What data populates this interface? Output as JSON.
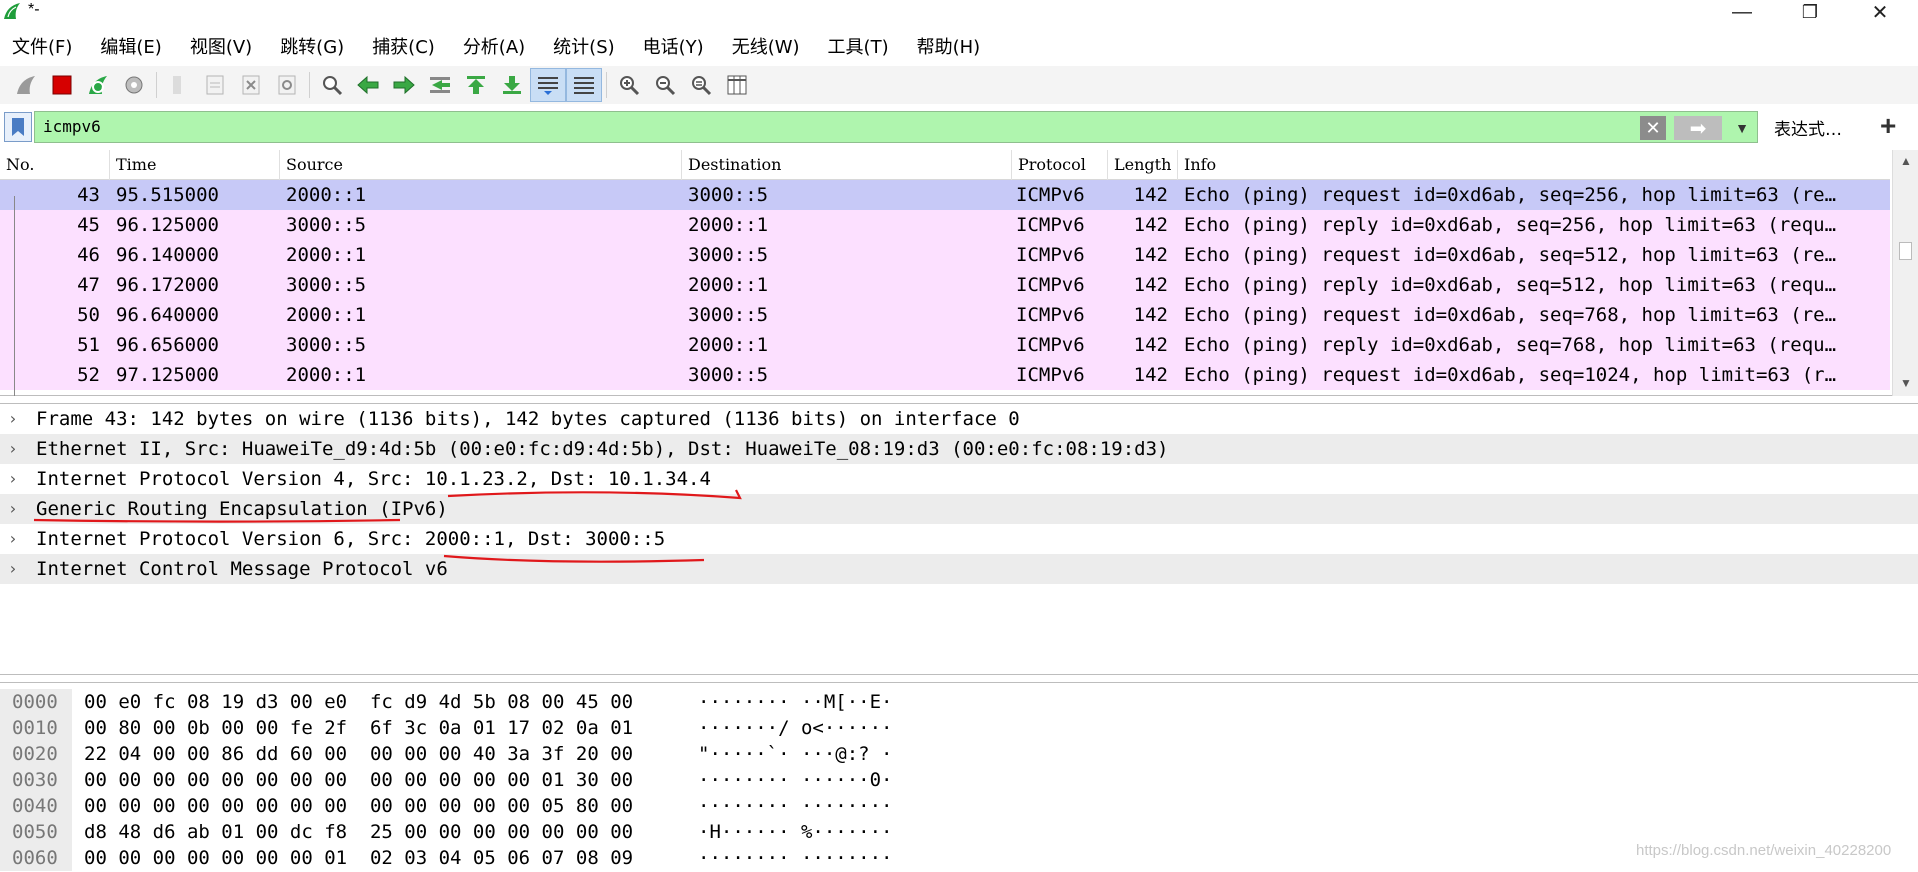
{
  "window": {
    "title": "*-",
    "minimize": "—",
    "restore": "❐",
    "close": "✕"
  },
  "menu": [
    "文件(F)",
    "编辑(E)",
    "视图(V)",
    "跳转(G)",
    "捕获(C)",
    "分析(A)",
    "统计(S)",
    "电话(Y)",
    "无线(W)",
    "工具(T)",
    "帮助(H)"
  ],
  "toolbar_icons": [
    "shark-fin-start-icon",
    "stop-capture-icon",
    "restart-capture-icon",
    "capture-options-icon",
    "open-file-icon",
    "save-file-icon",
    "close-file-icon",
    "reload-icon",
    "find-packet-icon",
    "go-back-icon",
    "go-forward-icon",
    "go-to-packet-icon",
    "go-first-icon",
    "go-last-icon",
    "autoscroll-icon",
    "colorize-icon",
    "zoom-in-icon",
    "zoom-out-icon",
    "zoom-normal-icon",
    "resize-columns-icon"
  ],
  "filter": {
    "value": "icmpv6",
    "expression_label": "表达式…",
    "add_label": "+"
  },
  "packet_list": {
    "columns": [
      "No.",
      "Time",
      "Source",
      "Destination",
      "Protocol",
      "Length",
      "Info"
    ],
    "rows": [
      {
        "no": "43",
        "time": "95.515000",
        "source": "2000::1",
        "destination": "3000::5",
        "protocol": "ICMPv6",
        "length": "142",
        "info": "Echo (ping) request id=0xd6ab, seq=256, hop limit=63 (re…"
      },
      {
        "no": "45",
        "time": "96.125000",
        "source": "3000::5",
        "destination": "2000::1",
        "protocol": "ICMPv6",
        "length": "142",
        "info": "Echo (ping) reply id=0xd6ab, seq=256, hop limit=63 (requ…"
      },
      {
        "no": "46",
        "time": "96.140000",
        "source": "2000::1",
        "destination": "3000::5",
        "protocol": "ICMPv6",
        "length": "142",
        "info": "Echo (ping) request id=0xd6ab, seq=512, hop limit=63 (re…"
      },
      {
        "no": "47",
        "time": "96.172000",
        "source": "3000::5",
        "destination": "2000::1",
        "protocol": "ICMPv6",
        "length": "142",
        "info": "Echo (ping) reply id=0xd6ab, seq=512, hop limit=63 (requ…"
      },
      {
        "no": "50",
        "time": "96.640000",
        "source": "2000::1",
        "destination": "3000::5",
        "protocol": "ICMPv6",
        "length": "142",
        "info": "Echo (ping) request id=0xd6ab, seq=768, hop limit=63 (re…"
      },
      {
        "no": "51",
        "time": "96.656000",
        "source": "3000::5",
        "destination": "2000::1",
        "protocol": "ICMPv6",
        "length": "142",
        "info": "Echo (ping) reply id=0xd6ab, seq=768, hop limit=63 (requ…"
      },
      {
        "no": "52",
        "time": "97.125000",
        "source": "2000::1",
        "destination": "3000::5",
        "protocol": "ICMPv6",
        "length": "142",
        "info": "Echo (ping) request id=0xd6ab, seq=1024, hop limit=63 (r…"
      }
    ],
    "selected_index": 0,
    "row_color": "#fce0ff",
    "selected_color": "#c7c9f7"
  },
  "details": [
    "Frame 43: 142 bytes on wire (1136 bits), 142 bytes captured (1136 bits) on interface 0",
    "Ethernet II, Src: HuaweiTe_d9:4d:5b (00:e0:fc:d9:4d:5b), Dst: HuaweiTe_08:19:d3 (00:e0:fc:08:19:d3)",
    "Internet Protocol Version 4, Src: 10.1.23.2, Dst: 10.1.34.4",
    "Generic Routing Encapsulation (IPv6)",
    "Internet Protocol Version 6, Src: 2000::1, Dst: 3000::5",
    "Internet Control Message Protocol v6"
  ],
  "annotation_color": "#e0181b",
  "bytes": [
    {
      "offset": "0000",
      "hex": "00 e0 fc 08 19 d3 00 e0  fc d9 4d 5b 08 00 45 00",
      "ascii": "········ ··M[··E·"
    },
    {
      "offset": "0010",
      "hex": "00 80 00 0b 00 00 fe 2f  6f 3c 0a 01 17 02 0a 01",
      "ascii": "·······/ o<······"
    },
    {
      "offset": "0020",
      "hex": "22 04 00 00 86 dd 60 00  00 00 00 40 3a 3f 20 00",
      "ascii": "\"·····`· ···@:? ·"
    },
    {
      "offset": "0030",
      "hex": "00 00 00 00 00 00 00 00  00 00 00 00 00 01 30 00",
      "ascii": "········ ······0·"
    },
    {
      "offset": "0040",
      "hex": "00 00 00 00 00 00 00 00  00 00 00 00 00 05 80 00",
      "ascii": "········ ········"
    },
    {
      "offset": "0050",
      "hex": "d8 48 d6 ab 01 00 dc f8  25 00 00 00 00 00 00 00",
      "ascii": "·H······ %·······"
    },
    {
      "offset": "0060",
      "hex": "00 00 00 00 00 00 00 01  02 03 04 05 06 07 08 09",
      "ascii": "········ ········"
    }
  ],
  "watermark": "https://blog.csdn.net/weixin_40228200"
}
